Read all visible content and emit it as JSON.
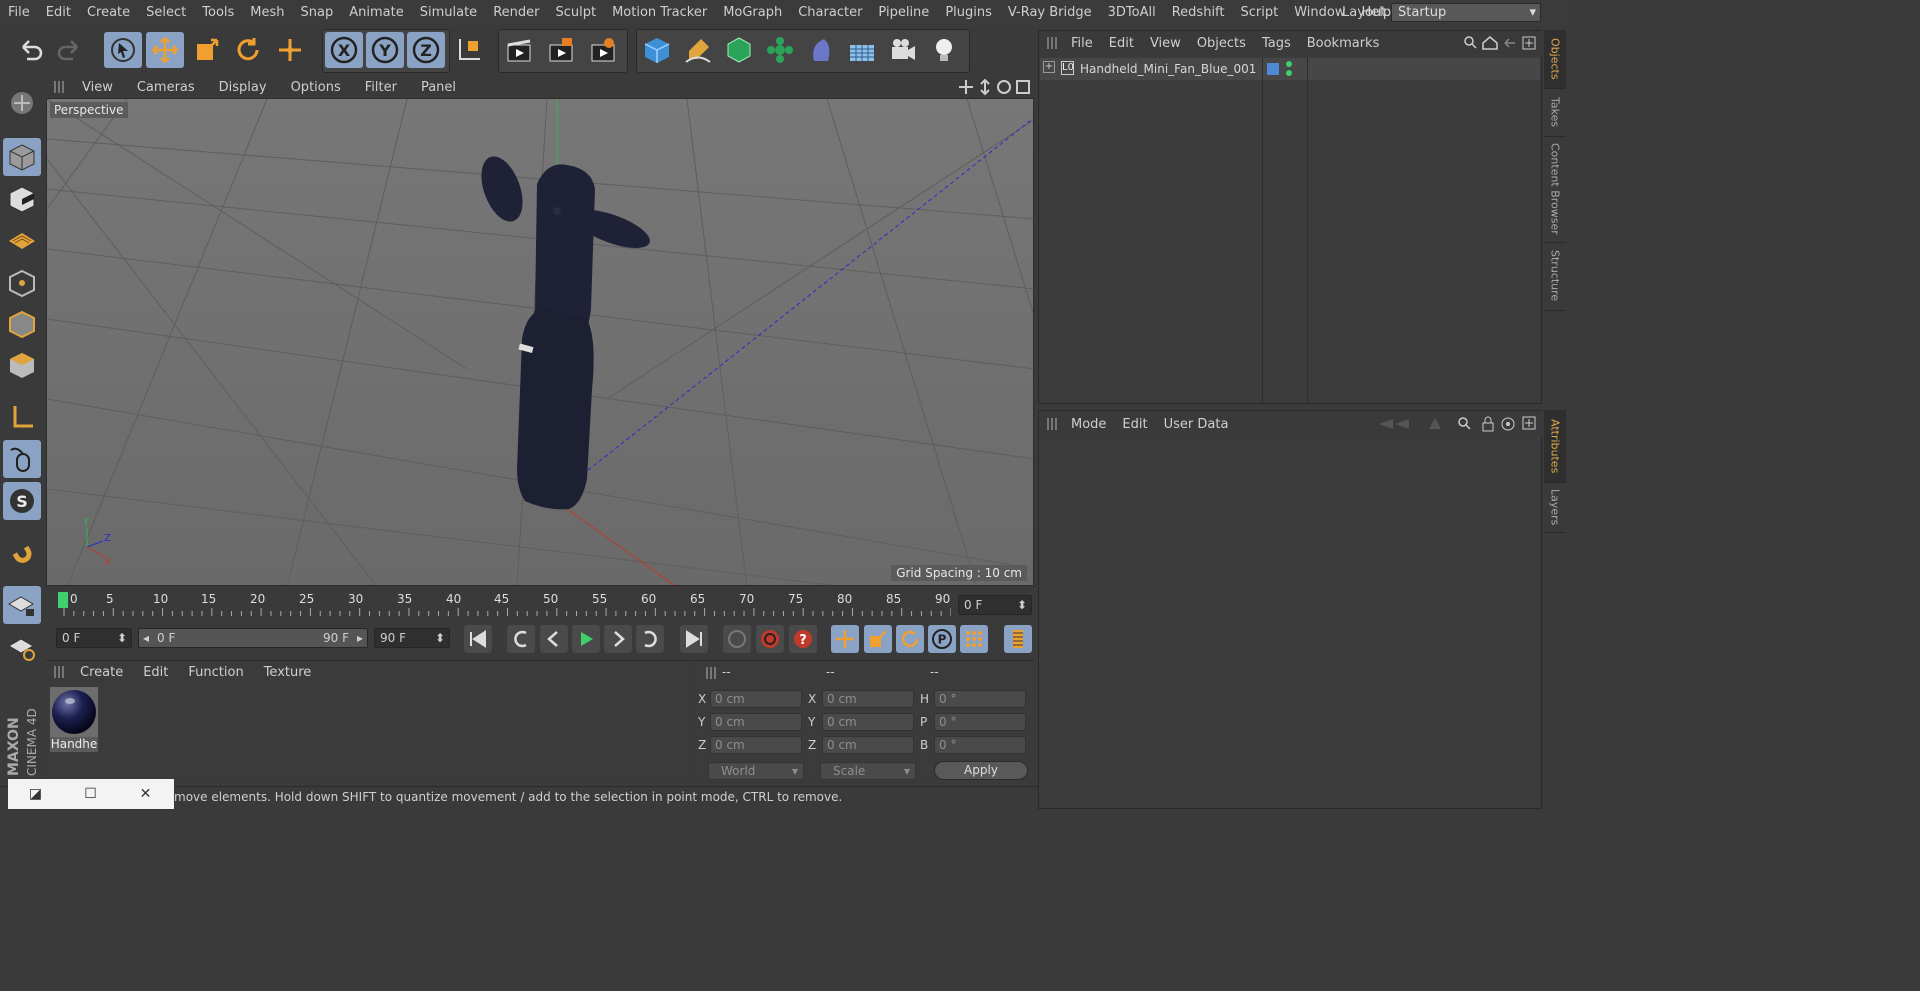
{
  "menubar": {
    "items": [
      "File",
      "Edit",
      "Create",
      "Select",
      "Tools",
      "Mesh",
      "Snap",
      "Animate",
      "Simulate",
      "Render",
      "Sculpt",
      "Motion Tracker",
      "MoGraph",
      "Character",
      "Pipeline",
      "Plugins",
      "V-Ray Bridge",
      "3DToAll",
      "Redshift",
      "Script",
      "Window",
      "Help"
    ],
    "layout_label": "Layout:",
    "layout_value": "Startup"
  },
  "viewport": {
    "menu": [
      "View",
      "Cameras",
      "Display",
      "Options",
      "Filter",
      "Panel"
    ],
    "label": "Perspective",
    "grid_spacing": "Grid Spacing : 10 cm"
  },
  "timeline": {
    "ticks": [
      "0",
      "5",
      "10",
      "15",
      "20",
      "25",
      "30",
      "35",
      "40",
      "45",
      "50",
      "55",
      "60",
      "65",
      "70",
      "75",
      "80",
      "85",
      "90"
    ],
    "current_frame": "0 F",
    "start_field": "0 F",
    "range_start": "0 F",
    "range_end": "90 F",
    "end_field": "90 F"
  },
  "material_manager": {
    "menu": [
      "Create",
      "Edit",
      "Function",
      "Texture"
    ],
    "material_name": "Handhe"
  },
  "coordinates": {
    "headers": [
      "--",
      "--",
      "--"
    ],
    "rows": [
      {
        "l1": "X",
        "v1": "0 cm",
        "l2": "X",
        "v2": "0 cm",
        "l3": "H",
        "v3": "0 °"
      },
      {
        "l1": "Y",
        "v1": "0 cm",
        "l2": "Y",
        "v2": "0 cm",
        "l3": "P",
        "v3": "0 °"
      },
      {
        "l1": "Z",
        "v1": "0 cm",
        "l2": "Z",
        "v2": "0 cm",
        "l3": "B",
        "v3": "0 °"
      }
    ],
    "mode_dropdown": "World",
    "scale_dropdown": "Scale",
    "apply_label": "Apply"
  },
  "objects_panel": {
    "menu": [
      "File",
      "Edit",
      "View",
      "Objects",
      "Tags",
      "Bookmarks"
    ],
    "object_name": "Handheld_Mini_Fan_Blue_001"
  },
  "attributes_panel": {
    "menu": [
      "Mode",
      "Edit",
      "User Data"
    ]
  },
  "side_tabs": {
    "top": [
      "Objects",
      "Takes",
      "Content Browser",
      "Structure"
    ],
    "bottom": [
      "Attributes",
      "Layers"
    ]
  },
  "status": {
    "text": "move elements. Hold down SHIFT to quantize movement / add to the selection in point mode, CTRL to remove."
  },
  "brand": {
    "maxon": "MAXON",
    "product": "CINEMA 4D"
  },
  "colors": {
    "accent_blue": "#8aa3c5",
    "active_tab": "#e0a94a",
    "fan_body": "#1f2137",
    "axis_red": "#c0392b",
    "axis_green": "#27ae60",
    "axis_blue": "#2c2cc8"
  }
}
